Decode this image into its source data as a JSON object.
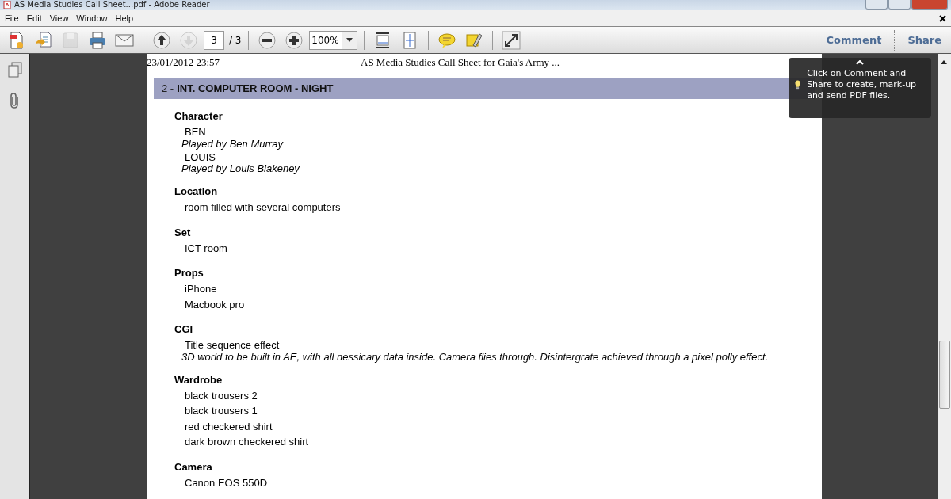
{
  "window": {
    "title": "AS Media Studies Call Sheet...pdf - Adobe Reader"
  },
  "menu": [
    "File",
    "Edit",
    "View",
    "Window",
    "Help"
  ],
  "toolbar": [
    {
      "kind": "create",
      "disabled": false
    },
    {
      "kind": "open",
      "disabled": false
    },
    {
      "kind": "save",
      "disabled": true
    },
    {
      "kind": "print",
      "disabled": false
    },
    {
      "kind": "mail",
      "disabled": false
    },
    {
      "kind": "sep"
    },
    {
      "kind": "up",
      "disabled": false
    },
    {
      "kind": "down",
      "disabled": true
    },
    {
      "kind": "page",
      "value": "3",
      "total": "/ 3"
    },
    {
      "kind": "sep"
    },
    {
      "kind": "minus",
      "disabled": false
    },
    {
      "kind": "plus",
      "disabled": false
    },
    {
      "kind": "zoom",
      "value": "100%"
    },
    {
      "kind": "sep"
    },
    {
      "kind": "fitwidth",
      "disabled": false
    },
    {
      "kind": "fitpage",
      "disabled": false
    },
    {
      "kind": "sep"
    },
    {
      "kind": "note",
      "disabled": false
    },
    {
      "kind": "highlight",
      "disabled": false
    },
    {
      "kind": "sep"
    },
    {
      "kind": "fullscreen",
      "disabled": false
    }
  ],
  "panel_buttons": [
    "Comment",
    "Share"
  ],
  "page": {
    "date": "23/01/2012 23:57",
    "doc_title": "AS Media Studies Call Sheet for Gaia's Army ...",
    "scene": {
      "number": "2 -",
      "title": "INT. COMPUTER ROOM - NIGHT"
    },
    "sections": [
      {
        "heading": "Character",
        "items": [
          {
            "text": "BEN",
            "note": "Played by Ben Murray"
          },
          {
            "text": "LOUIS",
            "note": "Played by Louis Blakeney"
          }
        ]
      },
      {
        "heading": "Location",
        "items": [
          {
            "text": "room filled with several computers"
          }
        ]
      },
      {
        "heading": "Set",
        "items": [
          {
            "text": "ICT room"
          }
        ]
      },
      {
        "heading": "Props",
        "items": [
          {
            "text": "iPhone"
          },
          {
            "text": "Macbook pro"
          }
        ]
      },
      {
        "heading": "CGI",
        "items": [
          {
            "text": "Title sequence effect",
            "note": "3D world to be built in AE, with all nessicary data inside. Camera flies through. Disintergrate achieved through a pixel polly effect."
          }
        ]
      },
      {
        "heading": "Wardrobe",
        "items": [
          {
            "text": "black trousers 2"
          },
          {
            "text": "black trousers 1"
          },
          {
            "text": "red checkered shirt"
          },
          {
            "text": "dark brown checkered shirt"
          }
        ]
      },
      {
        "heading": "Camera",
        "items": [
          {
            "text": "Canon EOS 550D"
          }
        ]
      }
    ]
  },
  "tooltip": {
    "text": "Click on Comment and Share to create, mark-up and send PDF files."
  }
}
